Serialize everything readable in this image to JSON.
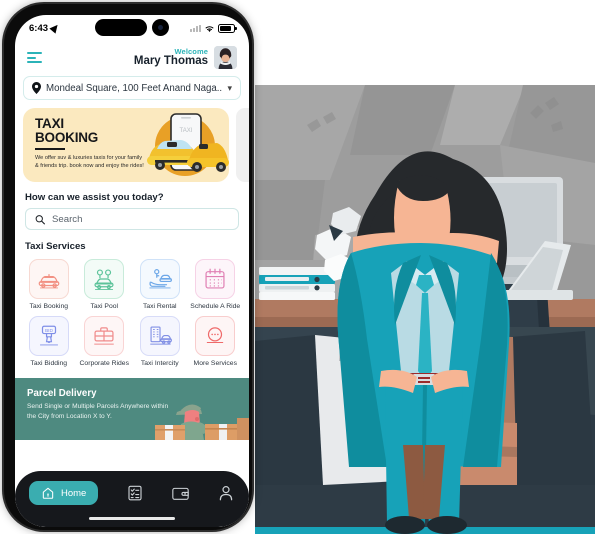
{
  "statusbar": {
    "time": "6:43",
    "location_icon": "location-arrow-icon",
    "signal_icon": "cellular-signal-icon",
    "wifi_icon": "wifi-icon",
    "battery_icon": "battery-icon"
  },
  "header": {
    "menu_icon": "hamburger-menu-icon",
    "welcome_label": "Welcome",
    "user_name": "Mary Thomas",
    "avatar": "user-avatar",
    "accent_color": "#2bb3b8"
  },
  "location": {
    "pin_icon": "map-pin-icon",
    "address": "Mondeal Square, 100 Feet Anand Naga...",
    "chevron_icon": "chevron-down-icon"
  },
  "promo": {
    "title_line1": "TAXI",
    "title_line2": "BOOKING",
    "description": "We offer suv & luxuries taxis for your family & friends trip. book now and enjoy the rides!",
    "bg_color": "#fbe9bf",
    "art": "taxi-phone-illustration"
  },
  "assist": {
    "heading": "How can we assist you today?"
  },
  "search": {
    "icon": "search-icon",
    "placeholder": "Search",
    "value": ""
  },
  "services": {
    "section_title": "Taxi Services",
    "items": [
      {
        "label": "Taxi Booking",
        "icon": "taxi-car-icon",
        "color": "#f29082",
        "bg": "#fef2ef"
      },
      {
        "label": "Taxi Pool",
        "icon": "carpool-icon",
        "color": "#5cc39a",
        "bg": "#eefaf4"
      },
      {
        "label": "Taxi Rental",
        "icon": "car-key-hand-icon",
        "color": "#6ea8e8",
        "bg": "#eff6fe"
      },
      {
        "label": "Schedule\nA Ride",
        "icon": "calendar-icon",
        "color": "#e080b4",
        "bg": "#fdf0f7"
      },
      {
        "label": "Taxi Bidding",
        "icon": "bid-tag-icon",
        "color": "#7f8fe8",
        "bg": "#f1f3fe"
      },
      {
        "label": "Corporate Rides",
        "icon": "briefcase-icon",
        "color": "#f08b8b",
        "bg": "#fef2f2"
      },
      {
        "label": "Taxi Intercity",
        "icon": "city-building-car-icon",
        "color": "#8190e5",
        "bg": "#f2f4fe"
      },
      {
        "label": "More Services",
        "icon": "more-dots-circle-icon",
        "color": "#ef6a6a",
        "bg": "#fef3f3"
      }
    ]
  },
  "parcel": {
    "title": "Parcel Delivery",
    "subtitle": "Send Single or Multiple Parcels Anywhere within the City from Location X to Y.",
    "bg_color": "#4e8a80",
    "art": "delivery-person-boxes-illustration"
  },
  "bottomnav": {
    "bg_color": "#16181c",
    "active_color": "#3aadb0",
    "items": [
      {
        "label": "Home",
        "icon": "home-icon",
        "active": true
      },
      {
        "label": "",
        "icon": "orders-list-icon",
        "active": false
      },
      {
        "label": "",
        "icon": "wallet-icon",
        "active": false
      },
      {
        "label": "",
        "icon": "profile-person-icon",
        "active": false
      }
    ]
  },
  "illustration": {
    "name": "stressed-businessman-office-illustration",
    "bg_color": "#9d9d9d",
    "suit_color": "#16a3b4",
    "skin_color": "#f6b594",
    "desk_color": "#b07a61"
  }
}
